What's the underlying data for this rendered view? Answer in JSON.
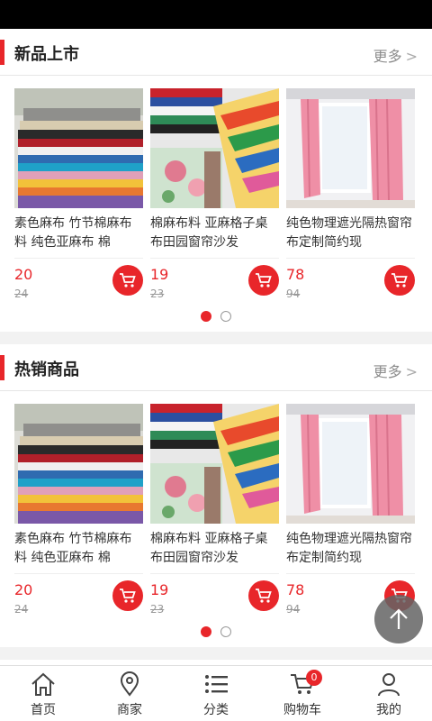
{
  "sections": [
    {
      "title": "新品上市",
      "more": "更多",
      "products": [
        {
          "name": "素色麻布 竹节棉麻布料 纯色亚麻布 棉",
          "price": "20",
          "old_price": "24"
        },
        {
          "name": "棉麻布料 亚麻格子桌布田园窗帘沙发",
          "price": "19",
          "old_price": "23"
        },
        {
          "name": "纯色物理遮光隔热窗帘布定制简约现",
          "price": "78",
          "old_price": "94"
        }
      ]
    },
    {
      "title": "热销商品",
      "more": "更多",
      "products": [
        {
          "name": "素色麻布 竹节棉麻布料 纯色亚麻布 棉",
          "price": "20",
          "old_price": "24"
        },
        {
          "name": "棉麻布料 亚麻格子桌布田园窗帘沙发",
          "price": "19",
          "old_price": "23"
        },
        {
          "name": "纯色物理遮光隔热窗帘布定制简约现",
          "price": "78",
          "old_price": "94"
        }
      ]
    }
  ],
  "tabbar": {
    "items": [
      {
        "label": "首页",
        "icon": "home-icon"
      },
      {
        "label": "商家",
        "icon": "location-pin-icon"
      },
      {
        "label": "分类",
        "icon": "list-icon"
      },
      {
        "label": "购物车",
        "icon": "cart-icon",
        "badge": "0"
      },
      {
        "label": "我的",
        "icon": "user-icon"
      }
    ]
  },
  "colors": {
    "accent": "#e8262a",
    "fab": "#646464"
  }
}
